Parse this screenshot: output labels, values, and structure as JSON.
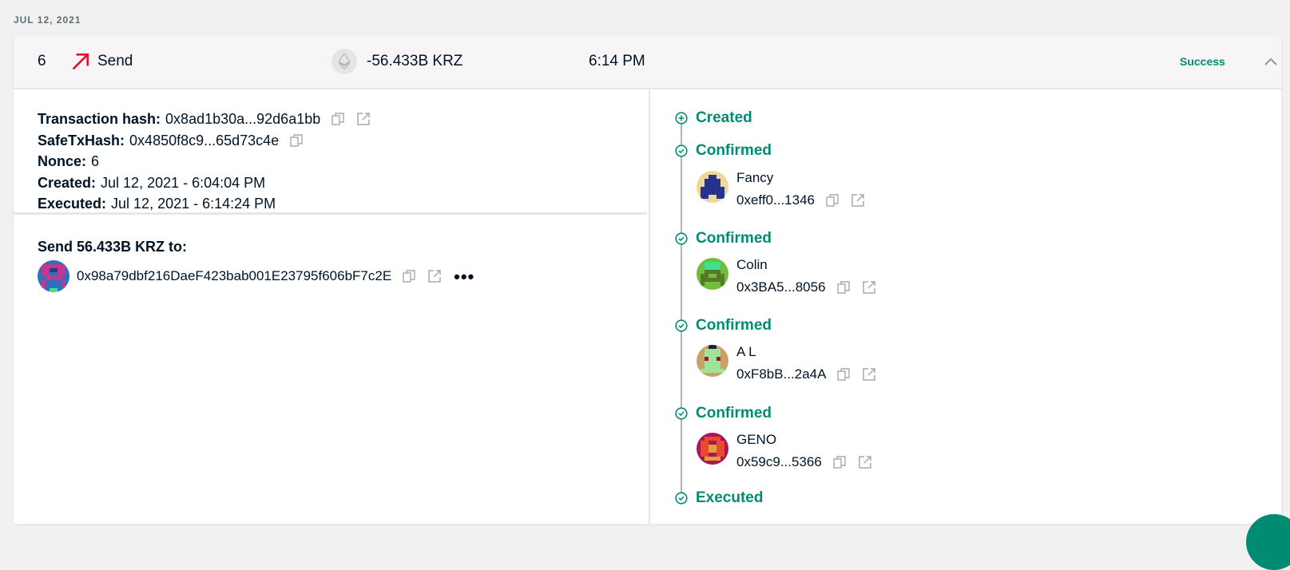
{
  "date_label": "JUL 12, 2021",
  "summary": {
    "nonce": "6",
    "type": "Send",
    "amount": "-56.433B KRZ",
    "time": "6:14 PM",
    "status": "Success"
  },
  "details": {
    "tx_hash_label": "Transaction hash:",
    "tx_hash": "0x8ad1b30a...92d6a1bb",
    "safe_tx_hash_label": "SafeTxHash:",
    "safe_tx_hash": "0x4850f8c9...65d73c4e",
    "nonce_label": "Nonce:",
    "nonce": "6",
    "created_label": "Created:",
    "created": "Jul 12, 2021 - 6:04:04 PM",
    "executed_label": "Executed:",
    "executed": "Jul 12, 2021 - 6:14:24 PM"
  },
  "recipient": {
    "title": "Send 56.433B KRZ to:",
    "address": "0x98a79dbf216DaeF423bab001E23795f606bF7c2E",
    "more": "•••"
  },
  "timeline": {
    "created": "Created",
    "confirmed": "Confirmed",
    "executed": "Executed",
    "owners": [
      {
        "name": "Fancy",
        "address": "0xeff0...1346"
      },
      {
        "name": "Colin",
        "address": "0x3BA5...8056"
      },
      {
        "name": "A L",
        "address": "0xF8bB...2a4A"
      },
      {
        "name": "GENO",
        "address": "0x59c9...5366"
      }
    ]
  },
  "colors": {
    "accent": "#008c73",
    "send_arrow": "#e8102e",
    "text": "#001428",
    "muted": "#5d6d74"
  }
}
